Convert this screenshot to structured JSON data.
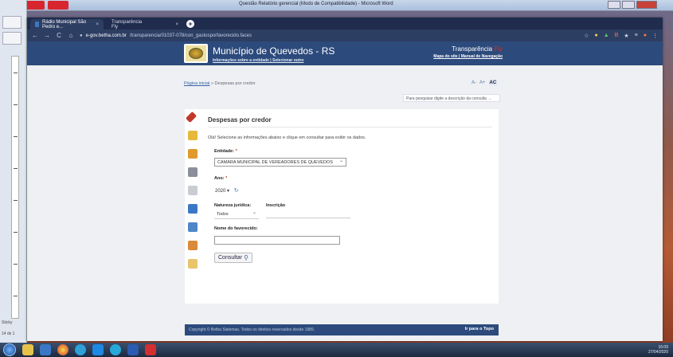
{
  "word_window": {
    "title": "Questão Relatório gerencial (Modo de Compatibilidade) - Microsoft Word",
    "side_label": "Sticky",
    "side_date": "14 ds 1"
  },
  "browser": {
    "tabs": [
      {
        "label": "Rádio Municipal São Pedro e...",
        "close": "×"
      },
      {
        "label": "Transparência Fly",
        "close": "×"
      }
    ],
    "new_tab": "+",
    "nav": {
      "back": "←",
      "forward": "→",
      "reload": "C",
      "home": "⌂"
    },
    "url_host": "e-gov.betha.com.br",
    "url_path": "/transparencia/01037-078/con_gastosporfavorecido.faces",
    "extensions": [
      "☆",
      "●",
      "▲",
      "B",
      "★",
      "≡",
      "●",
      "⋮"
    ]
  },
  "site": {
    "name": "Município de Quevedos - RS",
    "sub_text": "Informações sobre a entidade | Selecionar outro",
    "transparencia": "Transparência",
    "fly": "Fly",
    "links": "Mapa do site | Manual de Navegação"
  },
  "breadcrumb": {
    "home": "Página inicial",
    "sep": "»",
    "current": "Despesas por credor"
  },
  "font_controls": {
    "minus": "A-",
    "plus": "A+",
    "contrast": "AC"
  },
  "search_hint": "Para pesquisar digite a descrição da consulta →",
  "form": {
    "title": "Despesas por credor",
    "instructions": "Olá! Selecione as informações abaixo e clique em consultar para exibir os dados.",
    "entidade_label": "Entidade:",
    "entidade_value": "CAMARA MUNICIPAL DE VEREADORES DE QUEVEDOS",
    "ano_label": "Ano:",
    "ano_value": "2020",
    "ano_arrow": "▾",
    "refresh": "↻",
    "natureza_label": "Natureza jurídica:",
    "natureza_value": "Todos",
    "inscricao_label": "Inscrição",
    "nome_label": "Nome do favorecido:",
    "required_mark": "*",
    "consultar": "Consultar",
    "search_glyph": "⚲"
  },
  "footer": {
    "copyright": "Copyright © Betha Sistemas. Todos os direitos reservados desde 1989.",
    "top": "Ir para o Topo"
  },
  "tray": {
    "time": "16:09",
    "date": "27/04/2020"
  },
  "colors": {
    "header": "#2c4a7c",
    "chrome": "#2d3e63",
    "accent_red": "#c0392b"
  }
}
